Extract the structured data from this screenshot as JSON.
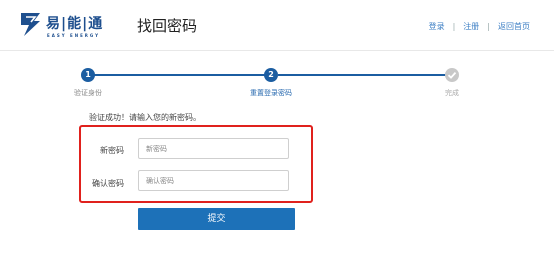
{
  "brand": {
    "name_cn": "易|能|通",
    "name_en": "EASY ENERGY",
    "color": "#1e4f8e"
  },
  "header": {
    "title": "找回密码",
    "nav": {
      "login": "登录",
      "register": "注册",
      "home": "返回首页",
      "separator": "|"
    }
  },
  "steps": [
    {
      "num": "1",
      "label": "验证身份",
      "state": "completed"
    },
    {
      "num": "2",
      "label": "重置登录密码",
      "state": "current"
    },
    {
      "num": "",
      "label": "完成",
      "state": "pending",
      "icon": "check-icon"
    }
  ],
  "message": "验证成功！请输入您的新密码。",
  "form": {
    "new_password": {
      "label": "新密码",
      "placeholder": "新密码"
    },
    "confirm_password": {
      "label": "确认密码",
      "placeholder": "确认密码"
    },
    "submit_label": "提交"
  },
  "colors": {
    "accent": "#1d71b8",
    "step_active": "#1b5da1",
    "step_pending": "#c8c8c8",
    "highlight_border": "#e0211d"
  }
}
